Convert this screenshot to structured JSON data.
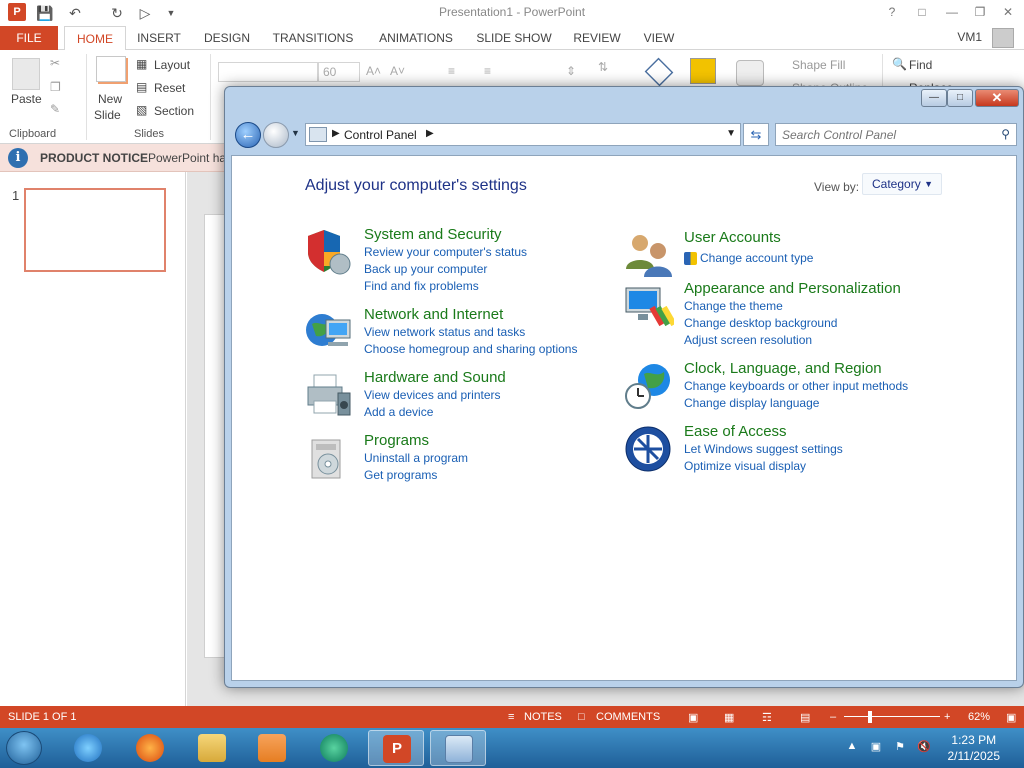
{
  "powerpoint": {
    "title": "Presentation1 - PowerPoint",
    "quick_access": {
      "undo_icon": "undo-icon",
      "redo_icon": "repeat-icon",
      "save_icon": "save-icon"
    },
    "window_controls": [
      "?",
      "□",
      "—",
      "❐",
      "✕"
    ],
    "tabs": [
      "FILE",
      "HOME",
      "INSERT",
      "DESIGN",
      "TRANSITIONS",
      "ANIMATIONS",
      "SLIDE SHOW",
      "REVIEW",
      "VIEW"
    ],
    "active_tab": "HOME",
    "user": "VM1",
    "ribbon": {
      "paste_label": "Paste",
      "clipboard_label": "Clipboard",
      "new_slide_label": "New",
      "new_slide_label2": "Slide",
      "layout_label": "Layout",
      "reset_label": "Reset",
      "section_label": "Section",
      "slides_label": "Slides",
      "font_size": "60",
      "shape_fill_label": "Shape Fill",
      "shape_outline_label": "Shape Outline",
      "find_label": "Find",
      "replace_label": "Replace"
    },
    "notice": {
      "title": "PRODUCT NOTICE",
      "text": "PowerPoint ha"
    },
    "slide_number": "1",
    "statusbar": {
      "slide_info": "SLIDE 1 OF 1",
      "notes": "NOTES",
      "comments": "COMMENTS",
      "zoom": "62%"
    }
  },
  "control_panel": {
    "address": {
      "location": "Control Panel"
    },
    "search": {
      "placeholder": "Search Control Panel"
    },
    "heading": "Adjust your computer's settings",
    "view_by": {
      "label": "View by:",
      "value": "Category"
    },
    "categories_left": [
      {
        "title": "System and Security",
        "icon": "shield-icon",
        "links": [
          "Review your computer's status",
          "Back up your computer",
          "Find and fix problems"
        ]
      },
      {
        "title": "Network and Internet",
        "icon": "network-globe-icon",
        "links": [
          "View network status and tasks",
          "Choose homegroup and sharing options"
        ]
      },
      {
        "title": "Hardware and Sound",
        "icon": "printer-icon",
        "links": [
          "View devices and printers",
          "Add a device"
        ]
      },
      {
        "title": "Programs",
        "icon": "programs-icon",
        "links": [
          "Uninstall a program",
          "Get programs"
        ]
      }
    ],
    "categories_right": [
      {
        "title": "User Accounts",
        "icon": "users-icon",
        "links": [
          "Change account type"
        ]
      },
      {
        "title": "Appearance and Personalization",
        "icon": "monitor-brush-icon",
        "links": [
          "Change the theme",
          "Change desktop background",
          "Adjust screen resolution"
        ]
      },
      {
        "title": "Clock, Language, and Region",
        "icon": "clock-globe-icon",
        "links": [
          "Change keyboards or other input methods",
          "Change display language"
        ]
      },
      {
        "title": "Ease of Access",
        "icon": "ease-of-access-icon",
        "links": [
          "Let Windows suggest settings",
          "Optimize visual display"
        ]
      }
    ]
  },
  "taskbar": {
    "apps": [
      "internet-explorer-icon",
      "firefox-icon",
      "file-explorer-icon",
      "media-player-icon",
      "edge-like-icon",
      "powerpoint-icon",
      "control-panel-icon"
    ],
    "time": "1:23 PM",
    "date": "2/11/2025"
  },
  "colors": {
    "powerpoint_accent": "#d24726",
    "category_title": "#1a7a1a",
    "link": "#1a5fb4",
    "heading": "#1e3287"
  }
}
